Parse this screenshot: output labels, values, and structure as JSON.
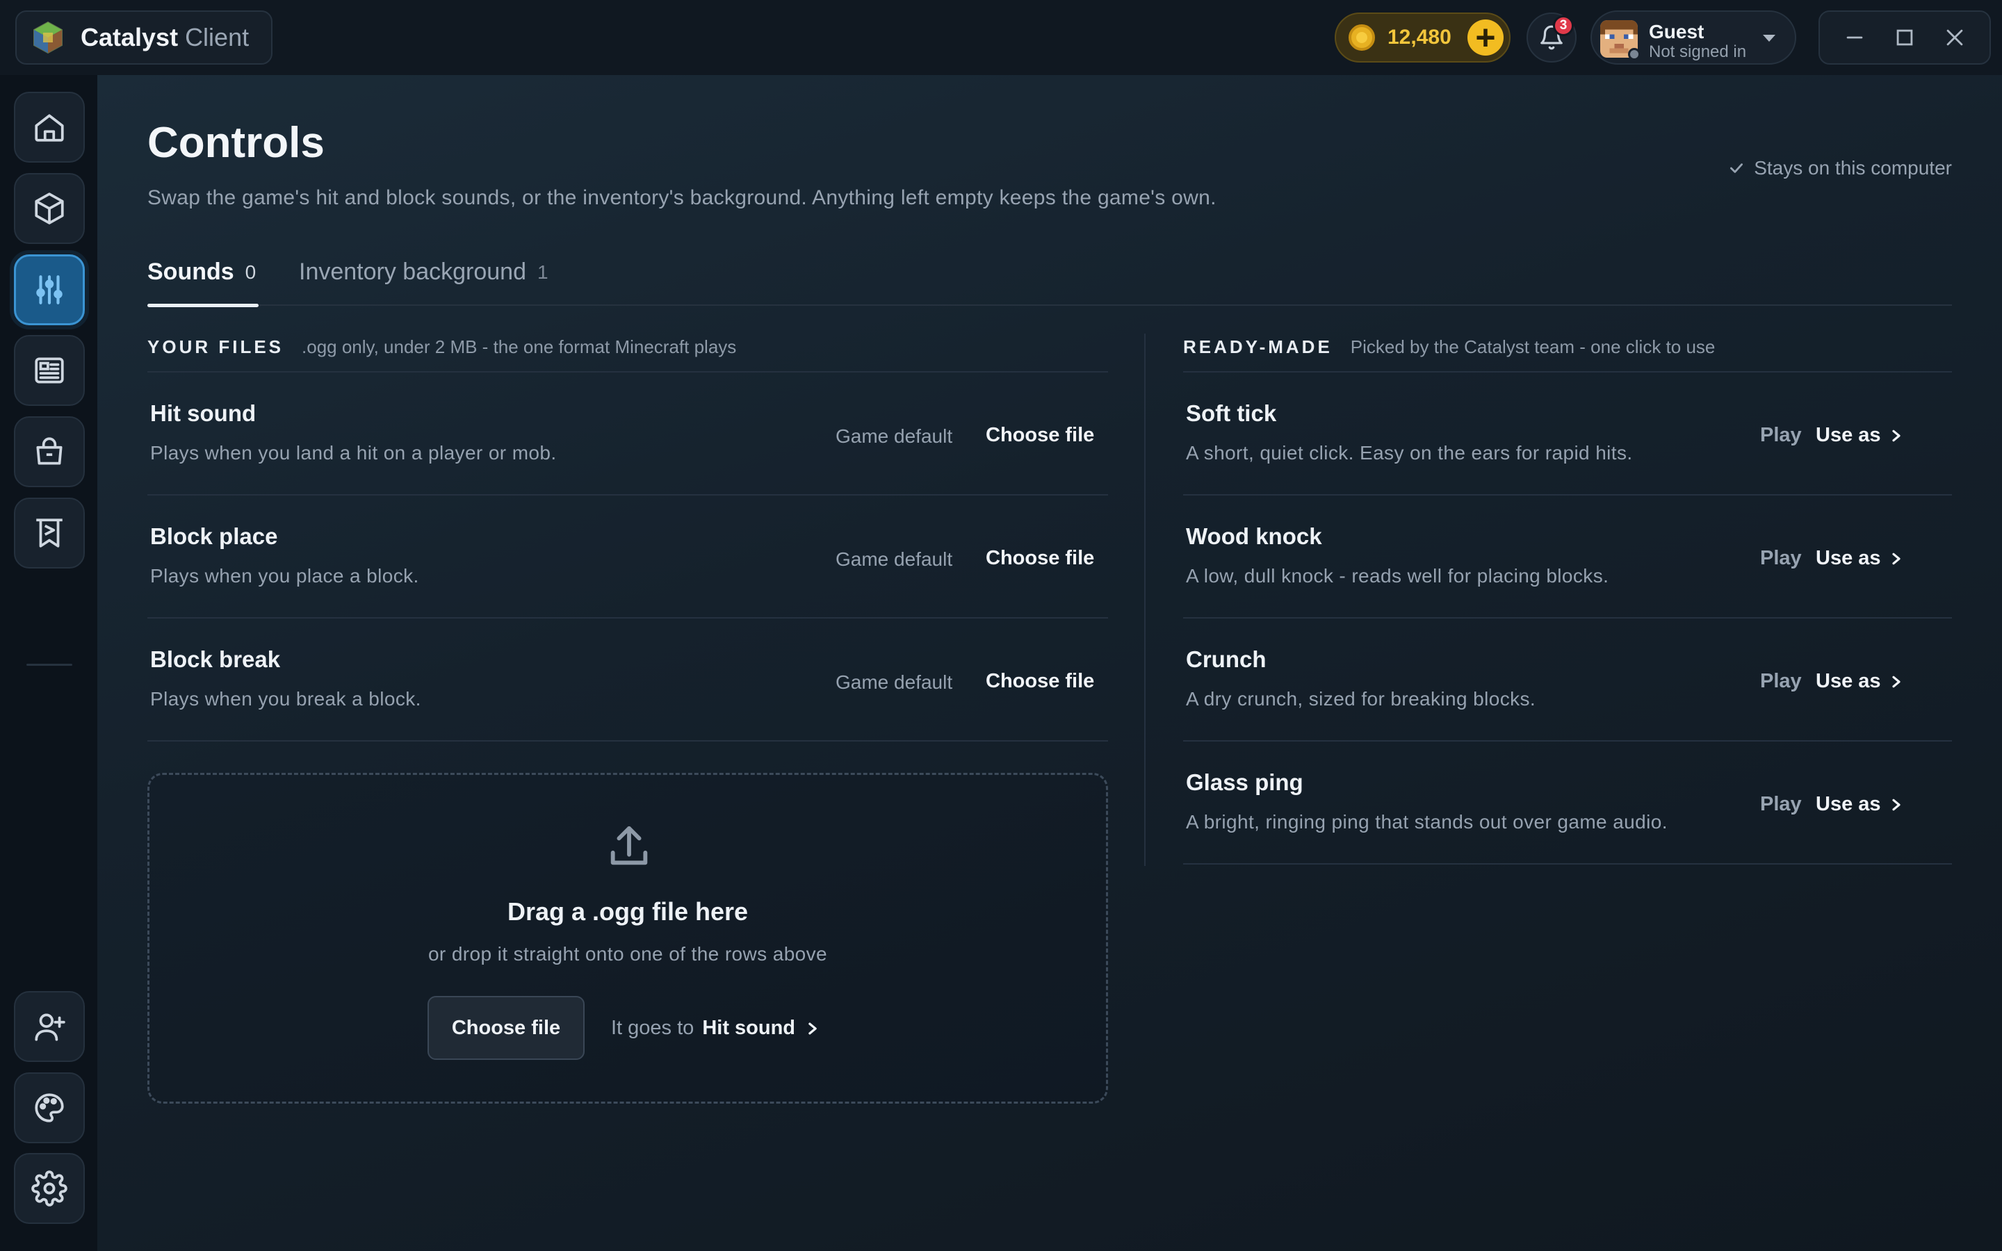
{
  "app": {
    "name": "Catalyst",
    "sub": "Client"
  },
  "header": {
    "coins": "12,480",
    "notifications_count": "3",
    "account": {
      "name": "Guest",
      "status": "Not signed in"
    }
  },
  "sidebar": {
    "items": [
      {
        "icon": "home-icon"
      },
      {
        "icon": "cube-icon"
      },
      {
        "icon": "sliders-icon",
        "active": true
      },
      {
        "icon": "news-icon"
      },
      {
        "icon": "shopping-bag-icon"
      },
      {
        "icon": "banner-icon"
      }
    ],
    "bottom": [
      {
        "icon": "add-friend-icon"
      },
      {
        "icon": "palette-icon"
      },
      {
        "icon": "gear-icon"
      }
    ]
  },
  "page": {
    "title": "Controls",
    "description": "Swap the game's hit and block sounds, or the inventory's background. Anything left empty keeps the game's own.",
    "stays": "Stays on this computer"
  },
  "tabs": [
    {
      "label": "Sounds",
      "count": "0",
      "active": true
    },
    {
      "label": "Inventory background",
      "count": "1",
      "active": false
    }
  ],
  "your_files": {
    "title": "YOUR FILES",
    "note": ".ogg only, under 2 MB - the one format Minecraft plays",
    "rows": [
      {
        "title": "Hit sound",
        "desc": "Plays when you land a hit on a player or mob.",
        "status": "Game default",
        "action": "Choose file"
      },
      {
        "title": "Block place",
        "desc": "Plays when you place a block.",
        "status": "Game default",
        "action": "Choose file"
      },
      {
        "title": "Block break",
        "desc": "Plays when you break a block.",
        "status": "Game default",
        "action": "Choose file"
      }
    ]
  },
  "ready_made": {
    "title": "READY-MADE",
    "note": "Picked by the Catalyst team - one click to use",
    "play_label": "Play",
    "use_label": "Use as",
    "rows": [
      {
        "title": "Soft tick",
        "desc": "A short, quiet click. Easy on the ears for rapid hits."
      },
      {
        "title": "Wood knock",
        "desc": "A low, dull knock - reads well for placing blocks."
      },
      {
        "title": "Crunch",
        "desc": "A dry crunch, sized for breaking blocks."
      },
      {
        "title": "Glass ping",
        "desc": "A bright, ringing ping that stands out over game audio."
      }
    ]
  },
  "dropzone": {
    "title": "Drag a .ogg file here",
    "subtitle": "or drop it straight onto one of the rows above",
    "button": "Choose file",
    "target_prefix": "It goes to",
    "target_name": "Hit sound"
  },
  "colors": {
    "accent": "#3b94d3",
    "coin": "#f2bc21",
    "badge": "#e0394a"
  }
}
